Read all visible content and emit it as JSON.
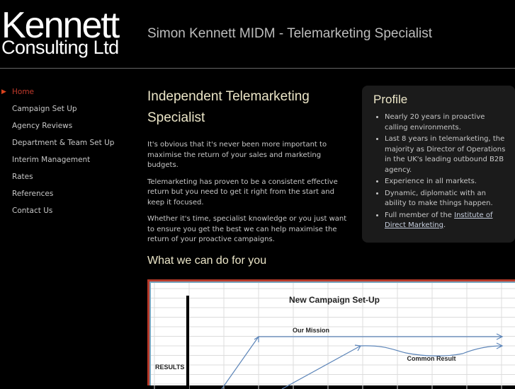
{
  "logo": {
    "line1": "Kennett",
    "line2": "Consulting Ltd"
  },
  "header": {
    "tagline": "Simon Kennett MIDM - Telemarketing Specialist"
  },
  "nav": {
    "items": [
      {
        "label": "Home",
        "active": true
      },
      {
        "label": "Campaign Set Up"
      },
      {
        "label": "Agency Reviews"
      },
      {
        "label": "Department & Team Set Up"
      },
      {
        "label": "Interim Management"
      },
      {
        "label": "Rates"
      },
      {
        "label": "References"
      },
      {
        "label": "Contact Us"
      }
    ],
    "active_icon": "triangle-right-icon"
  },
  "main": {
    "title": "Independent Telemarketing Specialist",
    "paragraphs": [
      "It's obvious that it's never been more important to maximise the return of your sales and marketing budgets.",
      "Telemarketing has proven to be a consistent effective return but you need to get it right from the start and keep it focused.",
      "Whether it's time, specialist knowledge or you just want to ensure you get the best we can help maximise the return of your proactive campaigns."
    ],
    "subtitle": "What we can do for you"
  },
  "profile": {
    "title": "Profile",
    "items": [
      "Nearly 20 years in proactive calling environments.",
      "Last 8 years in telemarketing, the majority as Director of Operations in the UK's leading outbound B2B agency.",
      "Experience in all markets.",
      "Dynamic, diplomatic with an ability to make things happen."
    ],
    "last_item_prefix": "Full member of the ",
    "last_item_link": "Institute of Direct Marketing",
    "last_item_suffix": "."
  },
  "chart_image": {
    "title": "New Campaign Set-Up",
    "mission_label": "Our Mission",
    "common_label": "Common Result",
    "y_label": "RESULTS"
  },
  "colors": {
    "accent": "#c0392b",
    "heading": "#ece6c8",
    "frame": "#b83a2a"
  }
}
